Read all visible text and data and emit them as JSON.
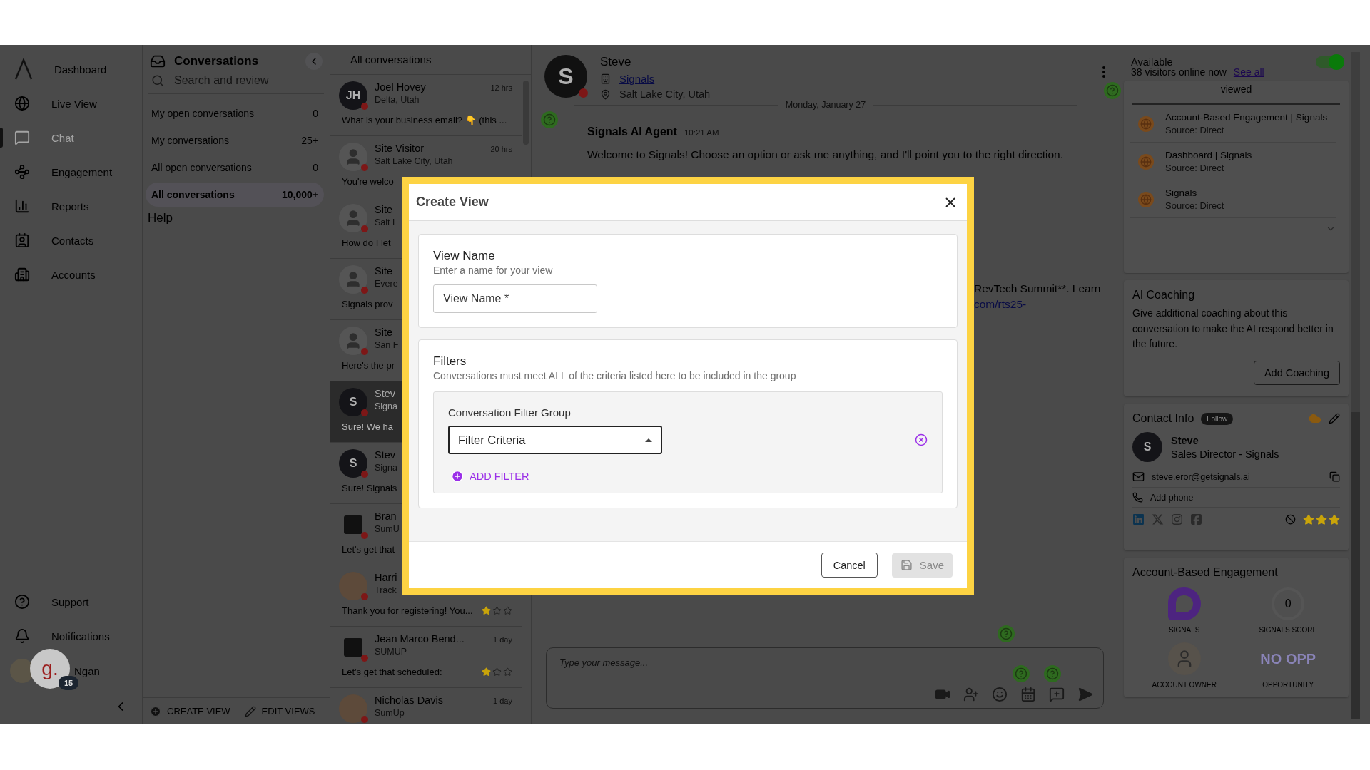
{
  "nav": {
    "items": [
      {
        "label": "Dashboard",
        "selected": false
      },
      {
        "label": "Live View",
        "selected": false
      },
      {
        "label": "Chat",
        "selected": true
      },
      {
        "label": "Engagement",
        "selected": false
      },
      {
        "label": "Reports",
        "selected": false
      },
      {
        "label": "Contacts",
        "selected": false
      },
      {
        "label": "Accounts",
        "selected": false
      }
    ],
    "bottom": [
      {
        "label": "Support"
      },
      {
        "label": "Notifications"
      }
    ],
    "user": {
      "name": "Ngan",
      "badge_letter": "g.",
      "badge_count": "15"
    }
  },
  "conversations": {
    "title": "Conversations",
    "search": {
      "placeholder": "Search and review"
    },
    "views": [
      {
        "label": "My open conversations",
        "count": "0",
        "selected": false
      },
      {
        "label": "My conversations",
        "count": "25+",
        "selected": false
      },
      {
        "label": "All open conversations",
        "count": "0",
        "selected": false
      },
      {
        "label": "All conversations",
        "count": "10,000+",
        "selected": true
      }
    ],
    "help": "Help",
    "actions": [
      "CREATE VIEW",
      "EDIT VIEWS"
    ]
  },
  "list": {
    "title": "All conversations",
    "rows": [
      {
        "kind": "initials",
        "initials": "JH",
        "name": "Joel Hovey",
        "detail": "Delta, Utah",
        "time": "12 hrs",
        "preview": "What is your business email? 👇 (this ...",
        "selected": false
      },
      {
        "kind": "person",
        "name": "Site Visitor",
        "detail": "Salt Lake City, Utah",
        "time": "20 hrs",
        "preview": "You're welco",
        "selected": false
      },
      {
        "kind": "person",
        "name": "Site",
        "detail": "Salt L",
        "preview": "How do I let",
        "selected": false
      },
      {
        "kind": "person",
        "name": "Site",
        "detail": "Evere",
        "preview": "Signals prov",
        "selected": false
      },
      {
        "kind": "person",
        "name": "Site",
        "detail": "San F",
        "preview": "Here's the pr",
        "selected": false
      },
      {
        "kind": "initials",
        "initials": "S",
        "name": "Stev",
        "detail": "Signa",
        "preview": "Sure! We ha",
        "selected": true
      },
      {
        "kind": "initials",
        "initials": "S",
        "name": "Stev",
        "detail": "Signa",
        "preview": "Sure! Signals",
        "selected": false
      },
      {
        "kind": "logo",
        "name": "Bran",
        "detail": "SumU",
        "preview": "Let's get that",
        "selected": false
      },
      {
        "kind": "photo",
        "name": "Harri",
        "detail": "Track",
        "preview": "Thank you for registering! You...",
        "stars": 1,
        "selected": false
      },
      {
        "kind": "logo",
        "name": "Jean Marco Bend...",
        "detail": "SUMUP",
        "time": "1 day",
        "preview": "Let's get that scheduled:",
        "stars": 1,
        "selected": false
      },
      {
        "kind": "photo",
        "name": "Nicholas Davis",
        "detail": "SumUp",
        "time": "1 day",
        "selected": false
      }
    ]
  },
  "chat": {
    "contact": {
      "initial": "S",
      "name": "Steve",
      "company": "Signals",
      "location": "Salt Lake City, Utah"
    },
    "date": "Monday, January 27",
    "message": {
      "sender": "Signals AI Agent",
      "time": "10:21 AM",
      "text": "Welcome to Signals! Choose an option or ask me anything, and I'll point you to the right direction."
    },
    "partial_text": "RevTech Summit**. Learn",
    "partial_link": "com/rts25-",
    "composer": {
      "placeholder": "Type your message..."
    }
  },
  "right": {
    "status": {
      "label": "Available",
      "on": true
    },
    "visitors": {
      "text": "38 visitors online now",
      "link": "See all"
    },
    "viewed": "viewed",
    "pages": [
      {
        "title": "Account-Based Engagement | Signals",
        "source": "Source: Direct"
      },
      {
        "title": "Dashboard | Signals",
        "source": "Source: Direct"
      },
      {
        "title": "Signals",
        "source": "Source: Direct"
      }
    ],
    "coaching": {
      "title": "AI Coaching",
      "text": "Give additional coaching about this conversation to make the AI respond better in the future.",
      "button": "Add Coaching"
    },
    "contact": {
      "title": "Contact Info",
      "follow": "Follow",
      "initial": "S",
      "name": "Steve",
      "role": "Sales Director - Signals",
      "email": "steve.eror@getsignals.ai",
      "phone": "Add phone",
      "stars": 3
    },
    "abe": {
      "title": "Account-Based Engagement",
      "metrics": [
        {
          "kind": "logo",
          "label": "SIGNALS"
        },
        {
          "kind": "score",
          "value": "0",
          "label": "SIGNALS SCORE"
        },
        {
          "kind": "photo",
          "label": "ACCOUNT OWNER"
        },
        {
          "kind": "text",
          "value": "NO OPP",
          "label": "OPPORTUNITY"
        }
      ]
    }
  },
  "modal": {
    "title": "Create View",
    "name_section": {
      "title": "View Name",
      "hint": "Enter a name for your view",
      "placeholder": "View Name *"
    },
    "filters": {
      "title": "Filters",
      "hint": "Conversations must meet ALL of the criteria listed here to be included in the group",
      "group": {
        "title": "Conversation Filter Group",
        "select": "Filter Criteria",
        "add": "ADD FILTER"
      }
    },
    "cancel": "Cancel",
    "save": {
      "label": "Save",
      "disabled": true
    }
  }
}
